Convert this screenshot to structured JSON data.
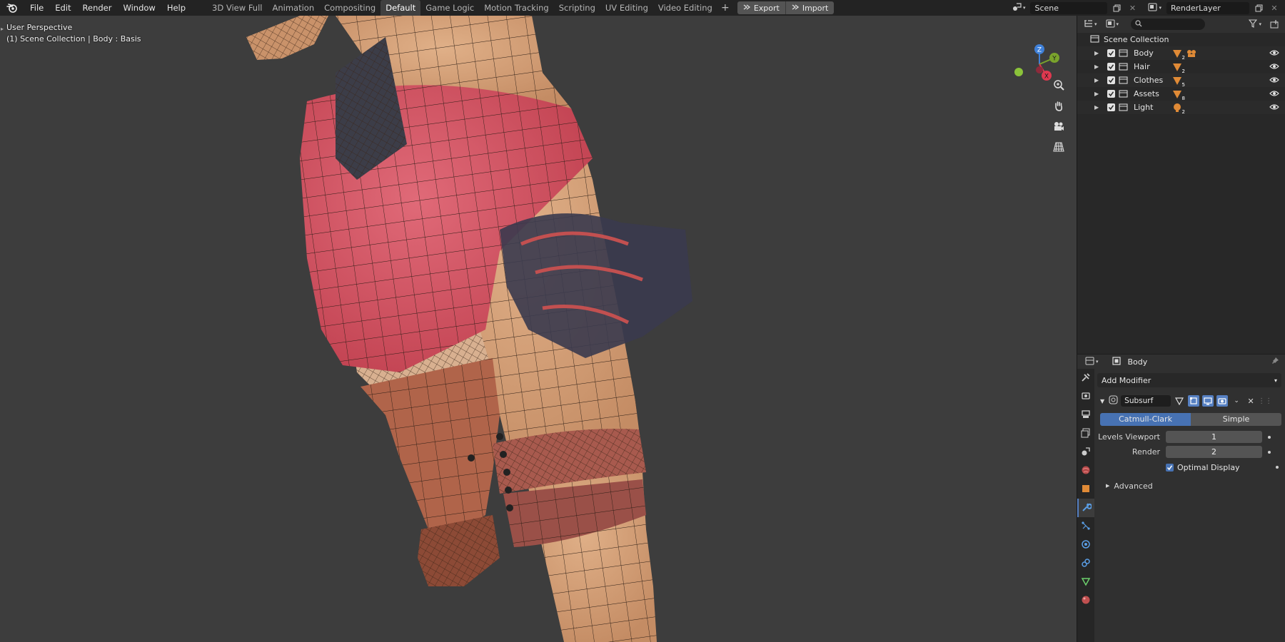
{
  "menu": [
    "File",
    "Edit",
    "Render",
    "Window",
    "Help"
  ],
  "workspaces": {
    "tabs": [
      "3D View Full",
      "Animation",
      "Compositing",
      "Default",
      "Game Logic",
      "Motion Tracking",
      "Scripting",
      "UV Editing",
      "Video Editing"
    ],
    "active": "Default",
    "add": "+"
  },
  "io": {
    "export_label": "Export",
    "import_label": "Import"
  },
  "scene": {
    "name": "Scene",
    "render_layer": "RenderLayer"
  },
  "viewport": {
    "perspective": "User Perspective",
    "context": "(1) Scene Collection | Body : Basis",
    "gizmo": {
      "z": "Z",
      "y": "Y",
      "x": "X"
    }
  },
  "outliner": {
    "root": "Scene Collection",
    "items": [
      {
        "label": "Body",
        "count": "2"
      },
      {
        "label": "Hair",
        "count": "2"
      },
      {
        "label": "Clothes",
        "count": "5"
      },
      {
        "label": "Assets",
        "count": "8"
      },
      {
        "label": "Light",
        "count": "2"
      }
    ]
  },
  "properties": {
    "object_name": "Body",
    "add_modifier": "Add Modifier",
    "modifier": {
      "name": "Subsurf",
      "mode_on": "Catmull-Clark",
      "mode_off": "Simple",
      "levels_viewport_label": "Levels Viewport",
      "levels_viewport": "1",
      "render_label": "Render",
      "render": "2",
      "optimal_display": "Optimal Display",
      "advanced": "Advanced"
    }
  },
  "colors": {
    "accent": "#4772b3",
    "axis_x": "#e0384f",
    "axis_y": "#7aa32c",
    "axis_z": "#3f80d8",
    "object_orange": "#e08a36"
  }
}
